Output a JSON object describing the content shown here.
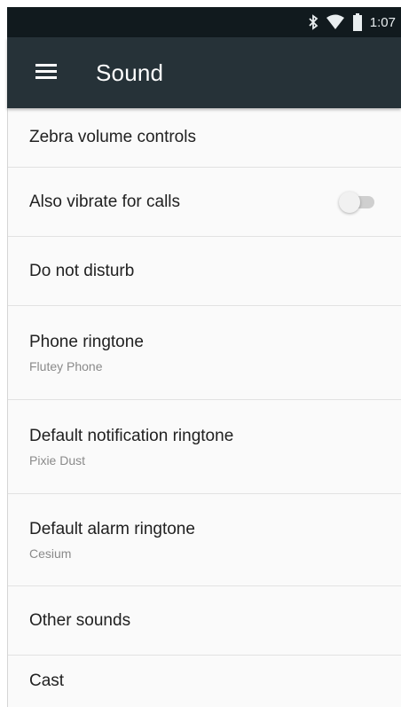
{
  "status_bar": {
    "time": "1:07",
    "icons": [
      "bluetooth-icon",
      "wifi-icon",
      "battery-icon"
    ]
  },
  "app_bar": {
    "menu_icon": "hamburger-menu-icon",
    "title": "Sound"
  },
  "colors": {
    "status_bar_bg": "#111a1e",
    "app_bar_bg": "#263238",
    "list_bg": "#fafafa",
    "primary_text": "#212121",
    "secondary_text": "#8a8a8a"
  },
  "settings": [
    {
      "title": "Zebra volume controls"
    },
    {
      "title": "Also vibrate for calls",
      "toggle": false
    },
    {
      "title": "Do not disturb"
    },
    {
      "title": "Phone ringtone",
      "summary": "Flutey Phone"
    },
    {
      "title": "Default notification ringtone",
      "summary": "Pixie Dust"
    },
    {
      "title": "Default alarm ringtone",
      "summary": "Cesium"
    },
    {
      "title": "Other sounds"
    },
    {
      "title": "Cast"
    }
  ]
}
